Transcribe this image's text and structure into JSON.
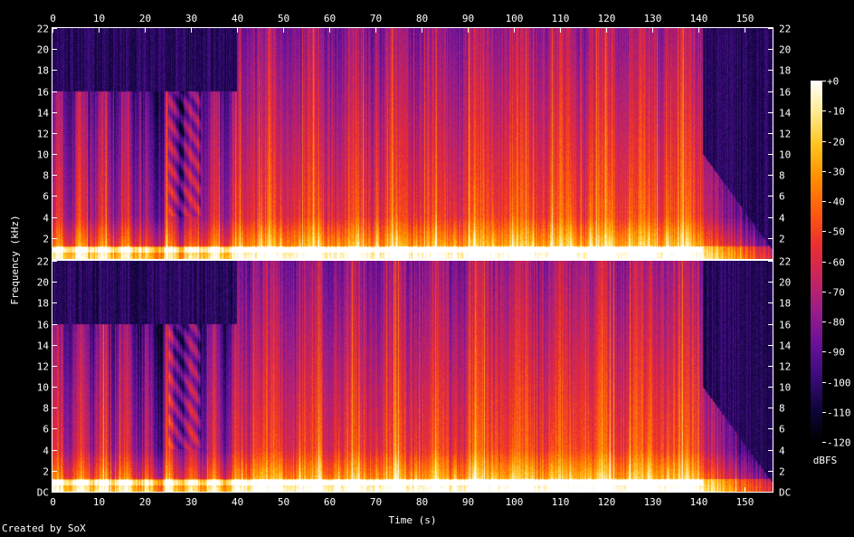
{
  "chart_data": {
    "type": "heatmap",
    "subtype": "spectrogram",
    "channels": 2,
    "xlabel": "Time (s)",
    "ylabel": "Frequency (kHz)",
    "xlim": [
      0,
      156
    ],
    "ylim": [
      0,
      22
    ],
    "x_ticks": [
      0,
      10,
      20,
      30,
      40,
      50,
      60,
      70,
      80,
      90,
      100,
      110,
      120,
      130,
      140,
      150
    ],
    "y_tick_values": [
      0,
      2,
      4,
      6,
      8,
      10,
      12,
      14,
      16,
      18,
      20,
      22
    ],
    "y_tick_labels_top": [
      "",
      "2",
      "4",
      "6",
      "8",
      "10",
      "12",
      "14",
      "16",
      "18",
      "20",
      "22"
    ],
    "y_tick_labels_bottom": [
      "DC",
      "2",
      "4",
      "6",
      "8",
      "10",
      "12",
      "14",
      "16",
      "18",
      "20",
      "22"
    ],
    "colorbar": {
      "label": "dBFS",
      "range": [
        -120,
        0
      ],
      "ticks": [
        0,
        -10,
        -20,
        -30,
        -40,
        -50,
        -60,
        -70,
        -80,
        -90,
        -100,
        -110,
        -120
      ],
      "tick_labels": [
        "+0",
        "-10",
        "-20",
        "-30",
        "-40",
        "-50",
        "-60",
        "-70",
        "-80",
        "-90",
        "-100",
        "-110",
        "-120"
      ],
      "colormap": [
        "#000000",
        "#10043c",
        "#3a0c7a",
        "#6a119a",
        "#9a1d88",
        "#c8245e",
        "#ec2f2f",
        "#ff5a10",
        "#ff8d00",
        "#ffc21a",
        "#ffe98c",
        "#ffffff"
      ]
    },
    "events": {
      "music_end_s": 141,
      "fade_tail_end_s": 155,
      "lowpass_16k_until_s": 40,
      "sparse_section_s": [
        25,
        32
      ],
      "dense_section_s": [
        41,
        141
      ],
      "onset_period_s": 4.2
    },
    "credit": "Created by SoX"
  }
}
